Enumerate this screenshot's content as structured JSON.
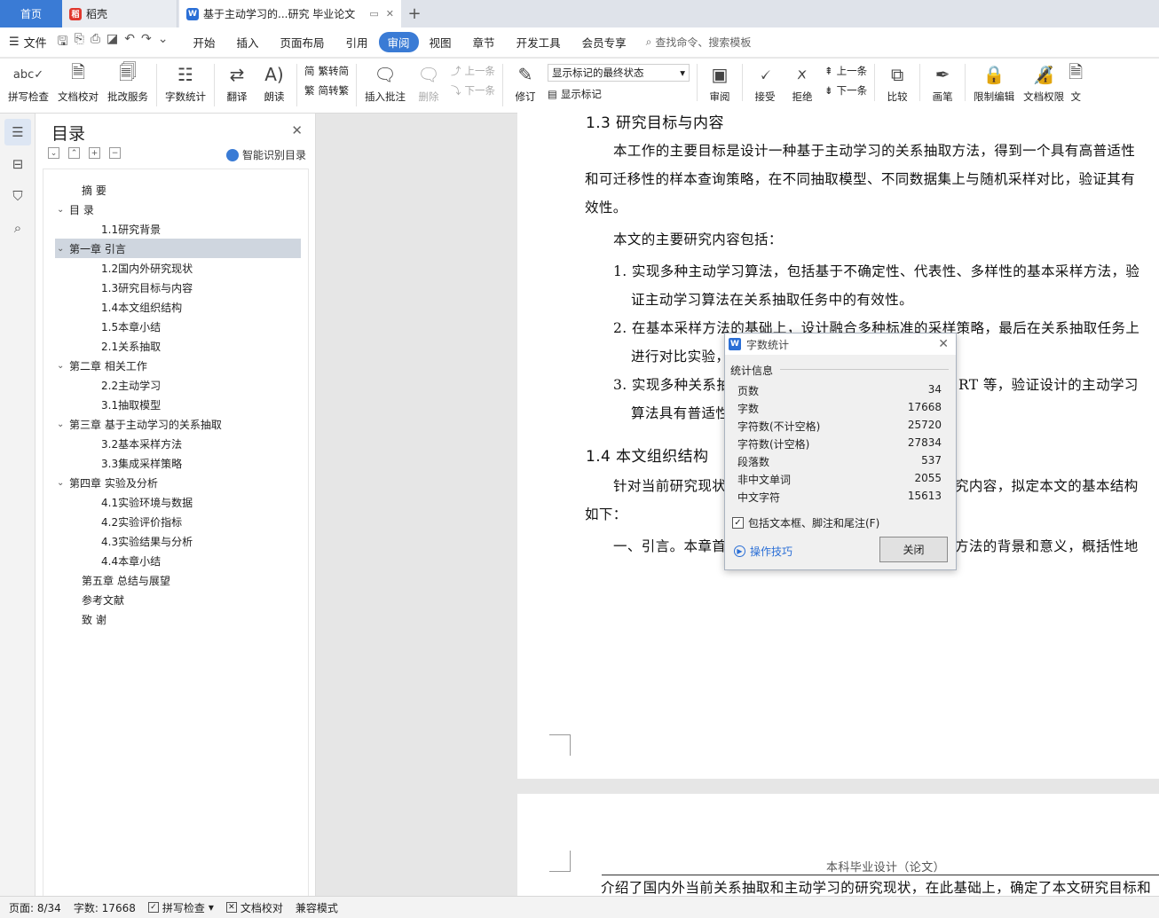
{
  "tabs": {
    "home": "首页",
    "daoke": "稻壳",
    "doc": "基于主动学习的...研究 毕业论文",
    "new_tab": "+"
  },
  "menu": {
    "file": "文件",
    "items": [
      "开始",
      "插入",
      "页面布局",
      "引用",
      "审阅",
      "视图",
      "章节",
      "开发工具",
      "会员专享"
    ],
    "active": "审阅",
    "search": "查找命令、搜索模板"
  },
  "ribbon": {
    "spell": "拼写检查",
    "proof": "文档校对",
    "batch": "批改服务",
    "count": "字数统计",
    "translate": "翻译",
    "read": "朗读",
    "t2s": "繁转简",
    "s2t": "简转繁",
    "insert_comment": "插入批注",
    "delete": "删除",
    "prev": "上一条",
    "next": "下一条",
    "revise": "修订",
    "markup_state": "显示标记的最终状态",
    "show_markup": "显示标记",
    "review": "审阅",
    "accept": "接受",
    "reject": "拒绝",
    "prev2": "上一条",
    "next2": "下一条",
    "compare": "比较",
    "pen": "画笔",
    "restrict": "限制编辑",
    "doc_rights": "文档权限",
    "more": "文"
  },
  "toc": {
    "title": "目录",
    "smart": "智能识别目录",
    "items": [
      {
        "text": "摘  要",
        "level": "l1x",
        "arrow": ""
      },
      {
        "text": "目  录",
        "level": "l1a",
        "arrow": "⌄"
      },
      {
        "text": "1.1研究背景",
        "level": "l2",
        "arrow": ""
      },
      {
        "text": "第一章  引言",
        "level": "l1a",
        "arrow": "⌄",
        "selected": true
      },
      {
        "text": "1.2国内外研究现状",
        "level": "l2",
        "arrow": ""
      },
      {
        "text": "1.3研究目标与内容",
        "level": "l2",
        "arrow": ""
      },
      {
        "text": "1.4本文组织结构",
        "level": "l2",
        "arrow": ""
      },
      {
        "text": "1.5本章小结",
        "level": "l2",
        "arrow": ""
      },
      {
        "text": "2.1关系抽取",
        "level": "l2",
        "arrow": ""
      },
      {
        "text": "第二章  相关工作",
        "level": "l1a",
        "arrow": "⌄"
      },
      {
        "text": "2.2主动学习",
        "level": "l2",
        "arrow": ""
      },
      {
        "text": "3.1抽取模型",
        "level": "l2",
        "arrow": ""
      },
      {
        "text": "第三章  基于主动学习的关系抽取",
        "level": "l1a",
        "arrow": "⌄"
      },
      {
        "text": "3.2基本采样方法",
        "level": "l2",
        "arrow": ""
      },
      {
        "text": "3.3集成采样策略",
        "level": "l2",
        "arrow": ""
      },
      {
        "text": "第四章  实验及分析",
        "level": "l1a",
        "arrow": "⌄"
      },
      {
        "text": "4.1实验环境与数据",
        "level": "l2",
        "arrow": ""
      },
      {
        "text": "4.2实验评价指标",
        "level": "l2",
        "arrow": ""
      },
      {
        "text": "4.3实验结果与分析",
        "level": "l2",
        "arrow": ""
      },
      {
        "text": "4.4本章小结",
        "level": "l2",
        "arrow": ""
      },
      {
        "text": "第五章  总结与展望",
        "level": "l1x",
        "arrow": ""
      },
      {
        "text": "参考文献",
        "level": "l1x",
        "arrow": ""
      },
      {
        "text": "致  谢",
        "level": "l1x",
        "arrow": ""
      }
    ]
  },
  "doc": {
    "h13": "1.3    研究目标与内容",
    "p1a": "本工作的主要目标是设计一种基于主动学习的关系抽取方法，得到一个具有高普适性",
    "p1b": "和可迁移性的样本查询策略，在不同抽取模型、不同数据集上与随机采样对比，验证其有",
    "p1c": "效性。",
    "p2": "本文的主要研究内容包括：",
    "l1a": "1.  实现多种主动学习算法，包括基于不确定性、代表性、多样性的基本采样方法，验",
    "l1b": "证主动学习算法在关系抽取任务中的有效性。",
    "l2a": "2.  在基本采样方法的基础上，设计融合多种标准的采样策略，最后在关系抽取任务上",
    "l2b": "进行对比实验，",
    "l3a": "3.  实现多种关系抽",
    "l3a_tail": "RT 等，验证设计的主动学习",
    "l3b": "算法具有普适性",
    "h14": "1.4    本文组织结构",
    "p3a": "针对当前研究现状",
    "p3a_tail": "究内容，拟定本文的基本结构",
    "p3b": "如下：",
    "p4a": "一、引言。本章首",
    "p4a_tail": "方法的背景和意义，概括性地",
    "p2_header": "本科毕业设计（论文）",
    "p2_line": "介绍了国内外当前关系抽取和主动学习的研究现状，在此基础上，确定了本文研究目标和"
  },
  "dialog": {
    "title": "字数统计",
    "section": "统计信息",
    "rows": [
      {
        "label": "页数",
        "value": "34"
      },
      {
        "label": "字数",
        "value": "17668"
      },
      {
        "label": "字符数(不计空格)",
        "value": "25720"
      },
      {
        "label": "字符数(计空格)",
        "value": "27834"
      },
      {
        "label": "段落数",
        "value": "537"
      },
      {
        "label": "非中文单词",
        "value": "2055"
      },
      {
        "label": "中文字符",
        "value": "15613"
      }
    ],
    "include": "包括文本框、脚注和尾注(F)",
    "tips": "操作技巧",
    "close": "关闭"
  },
  "status": {
    "page": "页面: 8/34",
    "words": "字数: 17668",
    "spell": "拼写检查",
    "proof": "文档校对",
    "compat": "兼容模式"
  }
}
